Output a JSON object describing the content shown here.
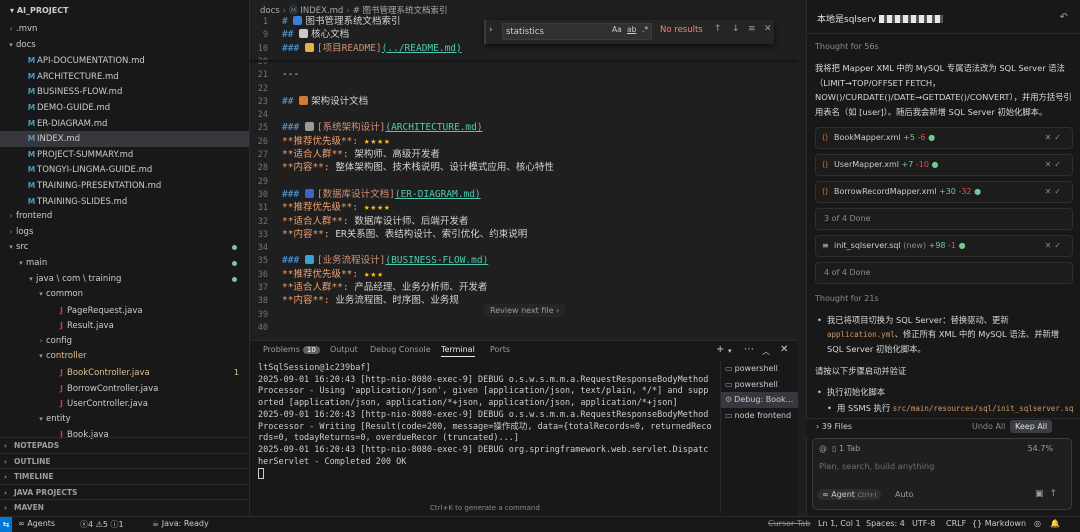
{
  "explorer": {
    "root": "AI_PROJECT",
    "rows": [
      {
        "label": ".mvn",
        "type": "folder",
        "open": false,
        "indent": 0
      },
      {
        "label": "docs",
        "type": "folder",
        "open": true,
        "indent": 0
      },
      {
        "label": "API-DOCUMENTATION.md",
        "type": "md",
        "indent": 1
      },
      {
        "label": "ARCHITECTURE.md",
        "type": "md",
        "indent": 1
      },
      {
        "label": "BUSINESS-FLOW.md",
        "type": "md",
        "indent": 1
      },
      {
        "label": "DEMO-GUIDE.md",
        "type": "md",
        "indent": 1
      },
      {
        "label": "ER-DIAGRAM.md",
        "type": "md",
        "indent": 1
      },
      {
        "label": "INDEX.md",
        "type": "md",
        "indent": 1,
        "selected": true
      },
      {
        "label": "PROJECT-SUMMARY.md",
        "type": "md",
        "indent": 1
      },
      {
        "label": "TONGYI-LINGMA-GUIDE.md",
        "type": "md",
        "indent": 1
      },
      {
        "label": "TRAINING-PRESENTATION.md",
        "type": "md",
        "indent": 1
      },
      {
        "label": "TRAINING-SLIDES.md",
        "type": "md",
        "indent": 1
      },
      {
        "label": "frontend",
        "type": "folder",
        "open": false,
        "indent": 0
      },
      {
        "label": "logs",
        "type": "folder",
        "open": false,
        "indent": 0
      },
      {
        "label": "src",
        "type": "folder",
        "open": true,
        "indent": 0,
        "dot": true
      },
      {
        "label": "main",
        "type": "folder",
        "open": true,
        "indent": 1,
        "dot": true
      },
      {
        "label": "java \\ com \\ training",
        "type": "folder",
        "open": true,
        "indent": 2,
        "dot": true
      },
      {
        "label": "common",
        "type": "folder",
        "open": true,
        "indent": 3
      },
      {
        "label": "PageRequest.java",
        "type": "java",
        "indent": 4
      },
      {
        "label": "Result.java",
        "type": "java",
        "indent": 4
      },
      {
        "label": "config",
        "type": "folder",
        "open": false,
        "indent": 3
      },
      {
        "label": "controller",
        "type": "folder",
        "open": true,
        "indent": 3,
        "mod": true
      },
      {
        "label": "BookController.java",
        "type": "java",
        "indent": 4,
        "mod": true,
        "num": "1"
      },
      {
        "label": "BorrowController.java",
        "type": "java",
        "indent": 4
      },
      {
        "label": "UserController.java",
        "type": "java",
        "indent": 4
      },
      {
        "label": "entity",
        "type": "folder",
        "open": true,
        "indent": 3
      },
      {
        "label": "Book.java",
        "type": "java",
        "indent": 4
      }
    ],
    "sections": [
      "NOTEPADS",
      "OUTLINE",
      "TIMELINE",
      "JAVA PROJECTS",
      "MAVEN"
    ]
  },
  "editor": {
    "breadcrumb": [
      "docs",
      "INDEX.md",
      "# 图书管理系统文档索引"
    ],
    "find": {
      "query": "statistics",
      "opt_case": "Aa",
      "opt_word": "ab",
      "opt_regex": ".*",
      "result": "No results"
    },
    "review_tip": "Review next file",
    "lines": [
      {
        "n": "1",
        "parts": [
          {
            "c": "hash",
            "t": "# "
          },
          {
            "c": "plain",
            "t": "图书管理系统文档索引"
          }
        ],
        "emoji": "#3b7dd8"
      },
      {
        "n": "9",
        "parts": [
          {
            "c": "hash",
            "t": "## "
          },
          {
            "c": "plain",
            "t": "核心文档"
          }
        ],
        "emoji": "#c8c8c8"
      },
      {
        "n": "10",
        "parts": [
          {
            "c": "hash",
            "t": "### "
          },
          {
            "c": "linktext",
            "t": "[项目README]"
          },
          {
            "c": "link",
            "t": "(../README.md)"
          }
        ],
        "emoji": "#e8b04a"
      },
      {
        "n": "20",
        "parts": []
      },
      {
        "n": "21",
        "parts": [
          {
            "c": "plain",
            "t": "---"
          }
        ]
      },
      {
        "n": "22",
        "parts": []
      },
      {
        "n": "23",
        "parts": [
          {
            "c": "hash",
            "t": "## "
          },
          {
            "c": "plain",
            "t": "架构设计文档"
          }
        ],
        "emoji": "#d07a3a"
      },
      {
        "n": "24",
        "parts": []
      },
      {
        "n": "25",
        "parts": [
          {
            "c": "hash",
            "t": "### "
          },
          {
            "c": "linktext",
            "t": "[系统架构设计]"
          },
          {
            "c": "link",
            "t": "(ARCHITECTURE.md)"
          }
        ],
        "emoji": "#9a9a9a"
      },
      {
        "n": "26",
        "parts": [
          {
            "c": "bold",
            "t": "**推荐优先级**: "
          },
          {
            "c": "stars",
            "t": "★★★★"
          }
        ]
      },
      {
        "n": "27",
        "parts": [
          {
            "c": "bold",
            "t": "**适合人群**: "
          },
          {
            "c": "plain",
            "t": "架构师、高级开发者"
          }
        ]
      },
      {
        "n": "28",
        "parts": [
          {
            "c": "bold",
            "t": "**内容**: "
          },
          {
            "c": "plain",
            "t": "整体架构图、技术栈说明、设计模式应用、核心特性"
          }
        ]
      },
      {
        "n": "29",
        "parts": []
      },
      {
        "n": "30",
        "parts": [
          {
            "c": "hash",
            "t": "### "
          },
          {
            "c": "linktext",
            "t": "[数据库设计文档]"
          },
          {
            "c": "link",
            "t": "(ER-DIAGRAM.md)"
          }
        ],
        "emoji": "#3a66c4"
      },
      {
        "n": "31",
        "parts": [
          {
            "c": "bold",
            "t": "**推荐优先级**: "
          },
          {
            "c": "stars",
            "t": "★★★★"
          }
        ]
      },
      {
        "n": "32",
        "parts": [
          {
            "c": "bold",
            "t": "**适合人群**: "
          },
          {
            "c": "plain",
            "t": "数据库设计师、后端开发者"
          }
        ]
      },
      {
        "n": "33",
        "parts": [
          {
            "c": "bold",
            "t": "**内容**: "
          },
          {
            "c": "plain",
            "t": "ER关系图、表结构设计、索引优化、约束说明"
          }
        ]
      },
      {
        "n": "34",
        "parts": []
      },
      {
        "n": "35",
        "parts": [
          {
            "c": "hash",
            "t": "### "
          },
          {
            "c": "linktext",
            "t": "[业务流程设计]"
          },
          {
            "c": "link",
            "t": "(BUSINESS-FLOW.md)"
          }
        ],
        "emoji": "#3aa0d8"
      },
      {
        "n": "36",
        "parts": [
          {
            "c": "bold",
            "t": "**推荐优先级**: "
          },
          {
            "c": "stars",
            "t": "★★★"
          }
        ]
      },
      {
        "n": "37",
        "parts": [
          {
            "c": "bold",
            "t": "**适合人群**: "
          },
          {
            "c": "plain",
            "t": "产品经理、业务分析师、开发者"
          }
        ]
      },
      {
        "n": "38",
        "parts": [
          {
            "c": "bold",
            "t": "**内容**: "
          },
          {
            "c": "plain",
            "t": "业务流程图、时序图、业务规"
          }
        ]
      },
      {
        "n": "39",
        "parts": []
      },
      {
        "n": "40",
        "parts": []
      }
    ]
  },
  "panel": {
    "tabs": {
      "problems": "Problems",
      "problems_count": "10",
      "output": "Output",
      "debug": "Debug Console",
      "terminal": "Terminal",
      "ports": "Ports"
    },
    "terminal_lines": [
      "ltSqlSession@1c239baf]",
      "2025-09-01 16:20:43 [http-nio-8080-exec-9] DEBUG o.s.w.s.m.m.a.RequestResponseBodyMethodProcessor - Using 'application/json', given [application/json, text/plain, */*] and supported [application/json, application/*+json, application/json, application/*+json]",
      "2025-09-01 16:20:43 [http-nio-8080-exec-9] DEBUG o.s.w.s.m.m.a.RequestResponseBodyMethodProcessor - Writing [Result(code=200, message=操作成功, data={totalRecords=0, returnedRecords=0, todayReturns=0, overdueRecor (truncated)...]",
      "2025-09-01 16:20:43 [http-nio-8080-exec-9] DEBUG org.springframework.web.servlet.DispatcherServlet - Completed 200 OK"
    ],
    "hint": "Ctrl+K to generate a command",
    "terminals": [
      "powershell",
      "powershell",
      "Debug: Book...",
      "node  frontend"
    ]
  },
  "chat": {
    "title": "本地是sqlserv",
    "thought1": "Thought for 56s",
    "para1": "我将把 Mapper XML 中的 MySQL 专属语法改为 SQL Server 语法（LIMIT→TOP/OFFSET FETCH，NOW()/CURDATE()/DATE→GETDATE()/CONVERT），并用方括号引用表名（如 [user]）。随后我会新增 SQL Server 初始化脚本。",
    "files": [
      {
        "name": "BookMapper.xml",
        "plus": "+5",
        "minus": "-6"
      },
      {
        "name": "UserMapper.xml",
        "plus": "+7",
        "minus": "-10"
      },
      {
        "name": "BorrowRecordMapper.xml",
        "plus": "+30",
        "minus": "-32"
      }
    ],
    "done1": "3 of 4 Done",
    "file4": {
      "name": "init_sqlserver.sql",
      "tag": "(new)",
      "plus": "+98",
      "minus": "-1"
    },
    "done2": "4 of 4 Done",
    "thought2": "Thought for 21s",
    "bullet1_a": "我已将项目切换为 SQL Server：替换驱动、更新 ",
    "bullet1_code": "application.yml",
    "bullet1_b": "、修正所有 XML 中的 MySQL 语法、并新增 SQL Server 初始化脚本。",
    "para2": "请按以下步骤启动并验证",
    "bullet2": "执行初始化脚本",
    "bullet3_a": "用 SSMS 执行 ",
    "bullet3_code": "src/main/resources/sql/init_sqlserver.sql",
    "files_bar": {
      "count": "39 Files",
      "undo": "Undo All",
      "keep": "Keep All"
    },
    "input": {
      "tab": "1 Tab",
      "pct": "54.7%",
      "placeholder": "Plan, search, build anything",
      "agent": "Agent",
      "agent_key": "Ctrl+I",
      "auto": "Auto"
    }
  },
  "statusbar": {
    "agents": "Agents",
    "errors": "4",
    "warnings": "5",
    "info": "1",
    "java": "Java: Ready",
    "cursor_tab": "Cursor Tab",
    "position": "Ln 1, Col 1",
    "spaces": "Spaces: 4",
    "encoding": "UTF-8",
    "eol": "CRLF",
    "lang": "Markdown"
  }
}
